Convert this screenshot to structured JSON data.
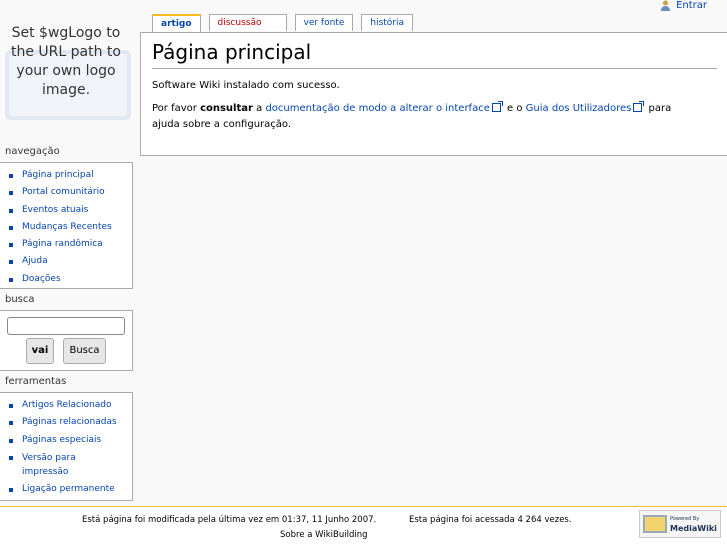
{
  "personal": {
    "login_label": "Entrar"
  },
  "logo": {
    "text": "Set $wgLogo to the URL path to your own logo image."
  },
  "tabs": [
    {
      "label": "artigo"
    },
    {
      "label": "discussão"
    },
    {
      "label": "ver fonte"
    },
    {
      "label": "história"
    }
  ],
  "content": {
    "title": "Página principal",
    "p1": "Software Wiki instalado com sucesso.",
    "p2_before": "Por favor ",
    "p2_bold": "consultar",
    "p2_a": " a ",
    "p2_link1": "documentação de modo a alterar o interface",
    "p2_b": " e o ",
    "p2_link2": "Guia dos Utilizadores",
    "p2_c": " para ajuda sobre a configuração."
  },
  "navigation": {
    "title": "navegação",
    "items": [
      "Página principal",
      "Portal comunitário",
      "Eventos atuais",
      "Mudanças Recentes",
      "Página randômica",
      "Ajuda",
      "Doações"
    ]
  },
  "search": {
    "title": "busca",
    "input_value": "",
    "go_label": "vai",
    "search_label": "Busca"
  },
  "tools": {
    "title": "ferramentas",
    "items": [
      "Artigos Relacionado",
      "Páginas relacionadas",
      "Páginas especiais",
      "Versão para impressão",
      "Ligação permanente"
    ]
  },
  "footer": {
    "last_modified": "Está página foi modificada pela última vez em 01:37, 11 Junho 2007.",
    "view_count": "Esta página foi acessada 4 264 vezes.",
    "about": "Sobre a WikiBuilding",
    "powered_small": "Powered By",
    "powered_name": "MediaWiki"
  },
  "colors": {
    "link": "#0645ad",
    "new_link": "#ba0000",
    "accent": "#fabd23"
  }
}
